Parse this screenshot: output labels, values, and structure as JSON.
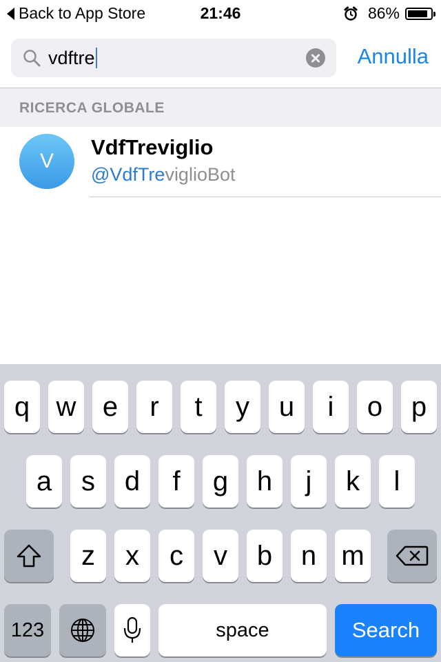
{
  "status_bar": {
    "back_label": "Back to App Store",
    "time": "21:46",
    "battery_percent": "86%",
    "battery_level": 0.86,
    "alarm_icon": "alarm-clock-icon"
  },
  "search": {
    "query": "vdftre",
    "cancel_label": "Annulla"
  },
  "section": {
    "title": "RICERCA GLOBALE"
  },
  "results": [
    {
      "avatar_letter": "V",
      "name": "VdfTreviglio",
      "username_match": "@VdfTre",
      "username_rest": "viglioBot"
    }
  ],
  "keyboard": {
    "row1": [
      "q",
      "w",
      "e",
      "r",
      "t",
      "y",
      "u",
      "i",
      "o",
      "p"
    ],
    "row2": [
      "a",
      "s",
      "d",
      "f",
      "g",
      "h",
      "j",
      "k",
      "l"
    ],
    "row3": [
      "z",
      "x",
      "c",
      "v",
      "b",
      "n",
      "m"
    ],
    "numbers_label": "123",
    "space_label": "space",
    "search_label": "Search",
    "accent_color": "#1a82fb"
  }
}
